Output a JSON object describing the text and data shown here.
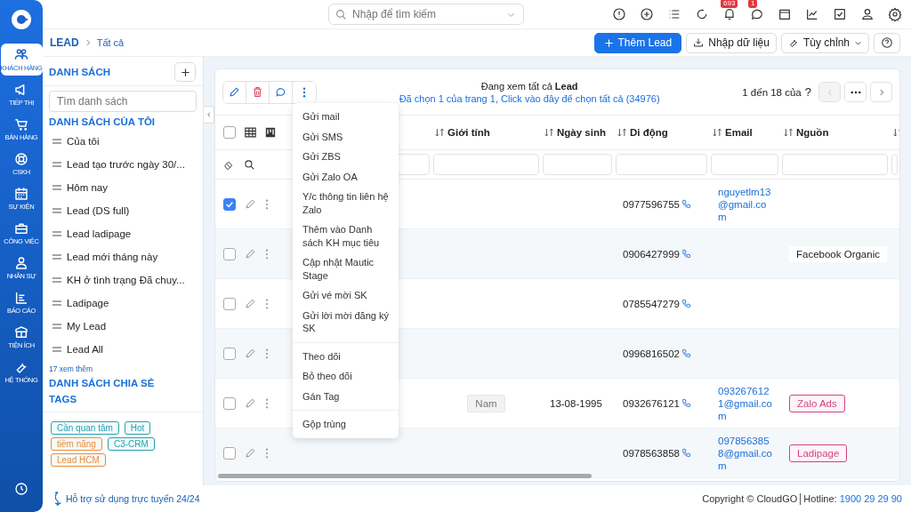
{
  "rail": {
    "items": [
      {
        "label": "KHÁCH HÀNG",
        "selected": true
      },
      {
        "label": "TIẾP THỊ",
        "selected": false
      },
      {
        "label": "BÁN HÀNG",
        "selected": false
      },
      {
        "label": "CSKH",
        "selected": false
      },
      {
        "label": "SỰ KIỆN",
        "selected": false
      },
      {
        "label": "CÔNG VIỆC",
        "selected": false
      },
      {
        "label": "NHÂN SỰ",
        "selected": false
      },
      {
        "label": "BÁO CÁO",
        "selected": false
      },
      {
        "label": "TIỆN ÍCH",
        "selected": false
      },
      {
        "label": "HỆ THỐNG",
        "selected": false
      }
    ]
  },
  "top_bar": {
    "search_placeholder": "Nhập để tìm kiếm",
    "bell_badge": "693",
    "chat_badge": "1"
  },
  "breadcrumb": [
    "LEAD",
    "Tất cả"
  ],
  "actions": {
    "add": "Thêm Lead",
    "import": "Nhập dữ liệu",
    "customize": "Tùy chỉnh"
  },
  "sidebar": {
    "title": "DANH SÁCH",
    "search_placeholder": "Tìm danh sách",
    "my_lists_title": "DANH SÁCH CỦA TÔI",
    "items": [
      "Của tôi",
      "Lead tạo trước ngày 30/...",
      "Hôm nay",
      "Lead (DS full)",
      "Lead ladipage",
      "Lead mới tháng này",
      "KH ở tình trạng Đã chuy...",
      "Ladipage",
      "My Lead",
      "Lead All"
    ],
    "more": "17 xem thêm",
    "shared_title": "DANH SÁCH CHIA SẺ",
    "tags_title": "TAGS",
    "tags": [
      {
        "label": "Cần quan tâm",
        "color": "#27a3ad"
      },
      {
        "label": "Hot",
        "color": "#27a3ad"
      },
      {
        "label": "tiềm năng",
        "color": "#ee8b3a"
      },
      {
        "label": "C3-CRM",
        "color": "#27a3ad"
      },
      {
        "label": "Lead HCM",
        "color": "#ee8b3a"
      }
    ],
    "support": "Hỗ trợ sử dụng trực tuyến 24/24"
  },
  "list": {
    "viewing": "Đang xem tất cả **Lead**",
    "selection": "Đã chọn 1 của trang 1, Click vào đây để chọn tất cả (34976)",
    "range": "1 đến 18 của",
    "range_unknown": "?",
    "select_all_checked": false,
    "columns": [
      "Giới tính",
      "Ngày sinh",
      "Di động",
      "Email",
      "Nguồn"
    ],
    "rows": [
      {
        "checked": true,
        "phone": "0977596755",
        "email": "nguyetlm13@gmail.com"
      },
      {
        "checked": false,
        "phone": "0906427999",
        "source": {
          "label": "Facebook Organic"
        }
      },
      {
        "checked": false,
        "phone": "0785547279"
      },
      {
        "checked": false,
        "phone": "0996816502"
      },
      {
        "checked": false,
        "gender": "Nam",
        "birthday": "13-08-1995",
        "phone": "0932676121",
        "email": "0932676121@gmail.com",
        "source": {
          "label": "Zalo Ads",
          "color": "#d2437f"
        }
      },
      {
        "checked": false,
        "phone": "0978563858",
        "email": "0978563858@gmail.com",
        "source": {
          "label": "Ladipage",
          "color": "#d2437f"
        }
      }
    ],
    "menu": [
      [
        "Gửi mail",
        "Gửi SMS",
        "Gửi ZBS",
        "Gửi Zalo OA",
        "Y/c thông tin liên hệ Zalo",
        "Thêm vào Danh sách KH mục tiêu",
        "Cập nhật Mautic Stage",
        "Gửi vé mời SK",
        "Gửi lời mời đăng ký SK"
      ],
      [
        "Theo dõi",
        "Bỏ theo dõi",
        "Gán Tag"
      ],
      [
        "Gộp trùng"
      ]
    ]
  },
  "footer": {
    "copyright": "Copyright © CloudGO",
    "hotline_label": "Hotline:",
    "hotline": "1900 29 29 90"
  }
}
